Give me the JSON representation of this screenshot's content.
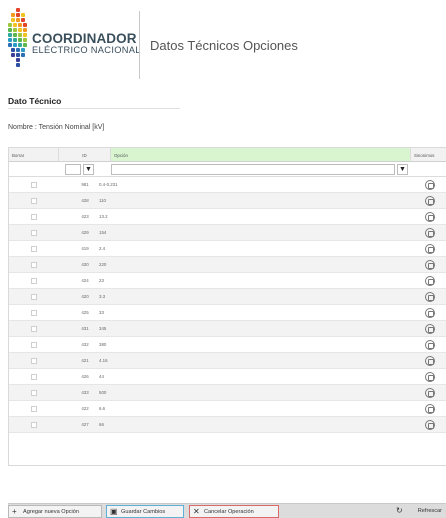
{
  "header": {
    "brand_main": "COORDINADOR",
    "brand_sub": "ELÉCTRICO NACIONAL",
    "title": "Datos Técnicos Opciones"
  },
  "section": {
    "title": "Dato Técnico",
    "name_line": "Nombre : Tensión Nominal [kV]"
  },
  "grid": {
    "columns": {
      "borrar": "Borrar",
      "id": "ID",
      "opcion": "Opción",
      "sinonimos": "Sinonimos"
    },
    "filter_icon": "filter-icon",
    "rows": [
      {
        "id": "981",
        "opcion": "0.4-0.231"
      },
      {
        "id": "428",
        "opcion": "110"
      },
      {
        "id": "423",
        "opcion": "13.2"
      },
      {
        "id": "429",
        "opcion": "154"
      },
      {
        "id": "419",
        "opcion": "2.4"
      },
      {
        "id": "430",
        "opcion": "220"
      },
      {
        "id": "424",
        "opcion": "23"
      },
      {
        "id": "420",
        "opcion": "3.3"
      },
      {
        "id": "425",
        "opcion": "33"
      },
      {
        "id": "431",
        "opcion": "345"
      },
      {
        "id": "432",
        "opcion": "380"
      },
      {
        "id": "421",
        "opcion": "4.16"
      },
      {
        "id": "426",
        "opcion": "44"
      },
      {
        "id": "433",
        "opcion": "500"
      },
      {
        "id": "422",
        "opcion": "6.6"
      },
      {
        "id": "427",
        "opcion": "66"
      }
    ]
  },
  "footer": {
    "add": "Agregar nueva Opción",
    "save": "Guardar Cambios",
    "cancel": "Cancelar Operación",
    "refresh": "Refrescar"
  },
  "colors": {
    "selected_header": "#d8f5d0",
    "save_border": "#5fb0d6",
    "cancel_border": "#d96a6a"
  }
}
